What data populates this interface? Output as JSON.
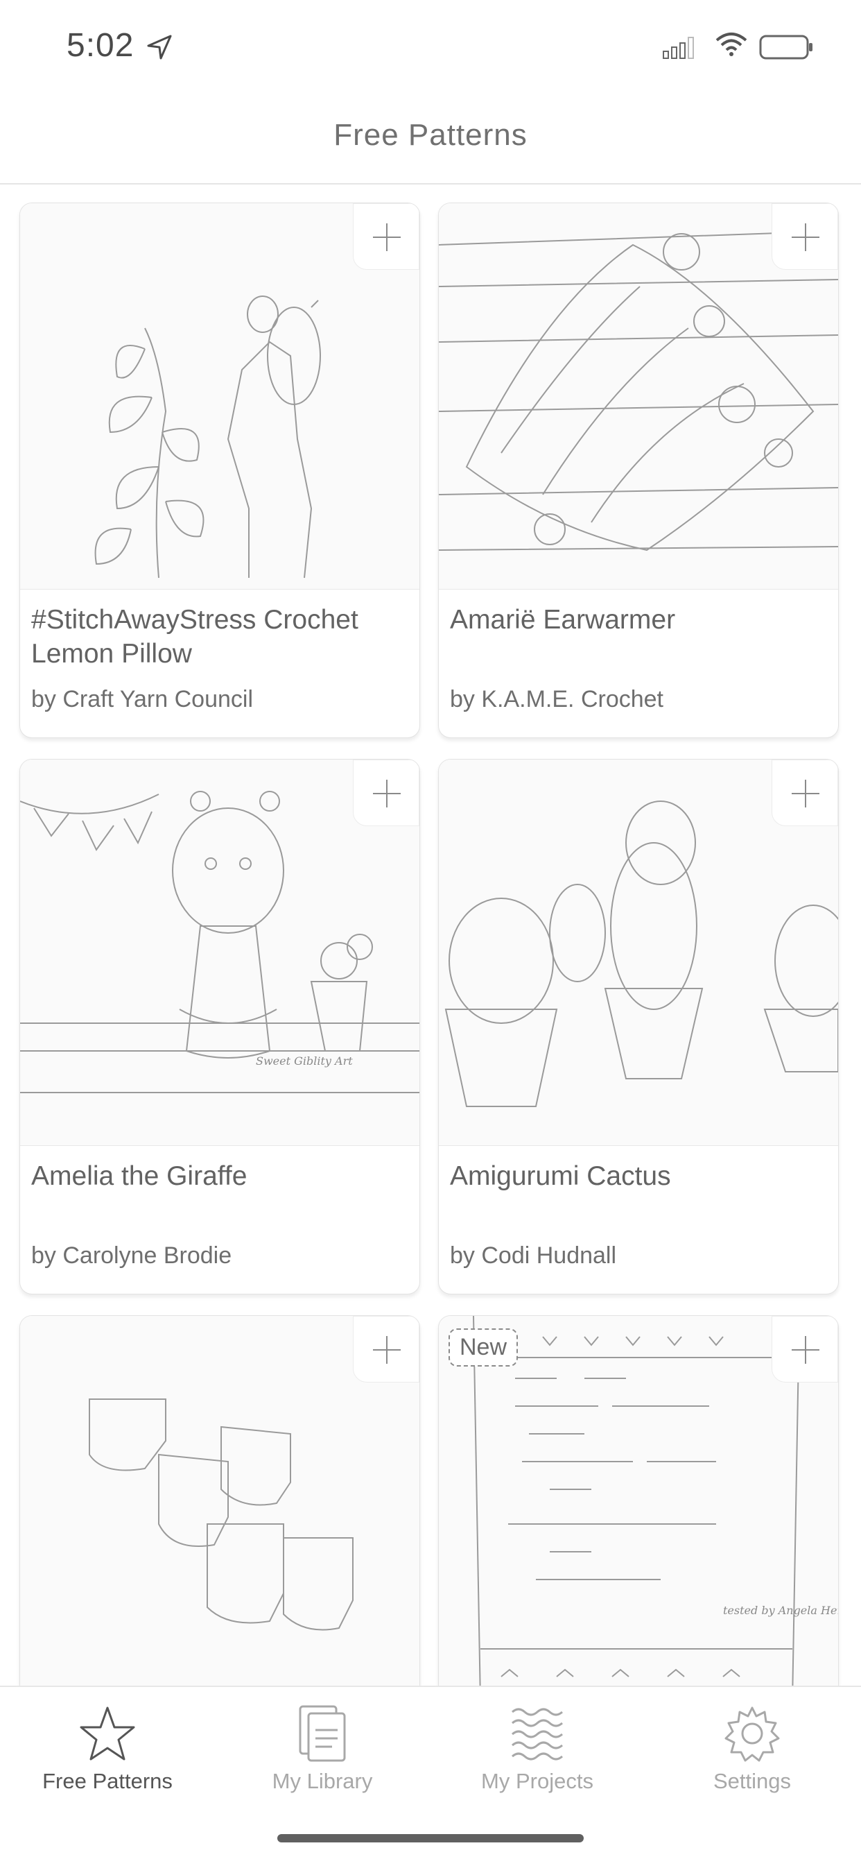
{
  "status_bar": {
    "time": "5:02"
  },
  "header": {
    "title": "Free Patterns"
  },
  "patterns": [
    {
      "title": "#StitchAwayStress Crochet Lemon Pillow",
      "author": "by Craft Yarn Council",
      "image": "woman-holding-lemon-pillow"
    },
    {
      "title": "Amariё Earwarmer",
      "author": "by K.A.M.E. Crochet",
      "image": "crochet-earwarmer-with-lemon-slices"
    },
    {
      "title": "Amelia the Giraffe",
      "author": "by Carolyne Brodie",
      "image": "crochet-giraffe-doll"
    },
    {
      "title": "Amigurumi Cactus",
      "author": "by Codi Hudnall",
      "image": "crochet-cacti-in-pots"
    },
    {
      "title": "",
      "author": "",
      "image": "crochet-baby-booties"
    },
    {
      "title": "",
      "author": "",
      "image": "knit-word-blanket",
      "badge": "New"
    }
  ],
  "image_text": {
    "giraffe_signature": "Sweet Giblity Art",
    "blanket_tester": "tested by Angela Hersh"
  },
  "tabs": [
    {
      "label": "Free Patterns",
      "icon": "star-icon",
      "active": true
    },
    {
      "label": "My Library",
      "icon": "library-icon",
      "active": false
    },
    {
      "label": "My Projects",
      "icon": "projects-icon",
      "active": false
    },
    {
      "label": "Settings",
      "icon": "gear-icon",
      "active": false
    }
  ]
}
